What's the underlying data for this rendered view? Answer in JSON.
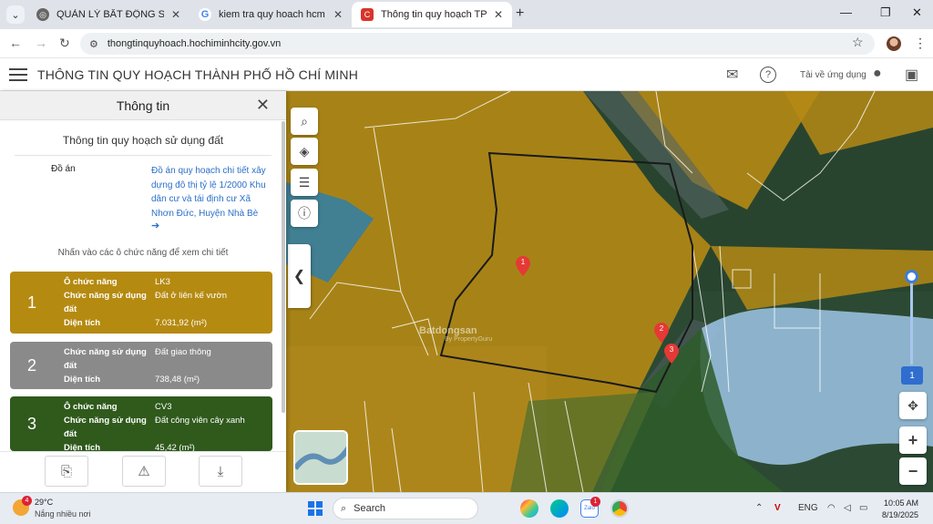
{
  "browser": {
    "tabs": [
      {
        "title": "QUẢN LÝ BẤT ĐỘNG SẢN"
      },
      {
        "title": "kiem tra quy hoach hcm - Goog"
      },
      {
        "title": "Thông tin quy hoạch TP.HCM"
      }
    ],
    "url": "thongtinquyhoach.hochiminhcity.gov.vn"
  },
  "app": {
    "title": "THÔNG TIN QUY HOẠCH THÀNH PHỐ HỒ CHÍ MINH",
    "download_label": "Tải về ứng dụng"
  },
  "panel": {
    "title": "Thông tin",
    "subtitle": "Thông tin quy hoạch sử dụng đất",
    "doan_label": "Đồ án",
    "doan_value": "Đồ án quy hoạch chi tiết xây dựng đô thị tỷ lệ 1/2000 Khu dân cư và tái định cư Xã Nhơn Đức, Huyện Nhà Bè",
    "hint": "Nhấn vào các ô chức năng để xem chi tiết",
    "cards": [
      {
        "num": "1",
        "color": "#b58a10",
        "rows": [
          {
            "k": "Ô chức năng",
            "v": "LK3"
          },
          {
            "k": "Chức năng sử dụng đất",
            "v": "Đất ở liên kế vườn"
          },
          {
            "k": "Diện tích",
            "v": "7.031,92 (m²)"
          }
        ]
      },
      {
        "num": "2",
        "color": "#8a8a8a",
        "rows": [
          {
            "k": "Chức năng sử dụng đất",
            "v": "Đất giao thông"
          },
          {
            "k": "Diện tích",
            "v": "738,48 (m²)"
          }
        ]
      },
      {
        "num": "3",
        "color": "#2f5a1c",
        "rows": [
          {
            "k": "Ô chức năng",
            "v": "CV3"
          },
          {
            "k": "Chức năng sử dụng đất",
            "v": "Đất công viên cây xanh"
          },
          {
            "k": "Diện tích",
            "v": "45,42 (m²)"
          }
        ]
      }
    ]
  },
  "map": {
    "watermark": "Batdongsan",
    "watermark_sub": "By PropertyGuru",
    "markers": [
      "1",
      "2",
      "3"
    ],
    "zoom_level": "1"
  },
  "taskbar": {
    "weather_badge": "4",
    "temp": "29°C",
    "condition": "Nắng nhiều nơi",
    "search": "Search",
    "zalo_badge": "1",
    "lang": "ENG",
    "time": "10:05 AM",
    "date": "8/19/2025"
  }
}
